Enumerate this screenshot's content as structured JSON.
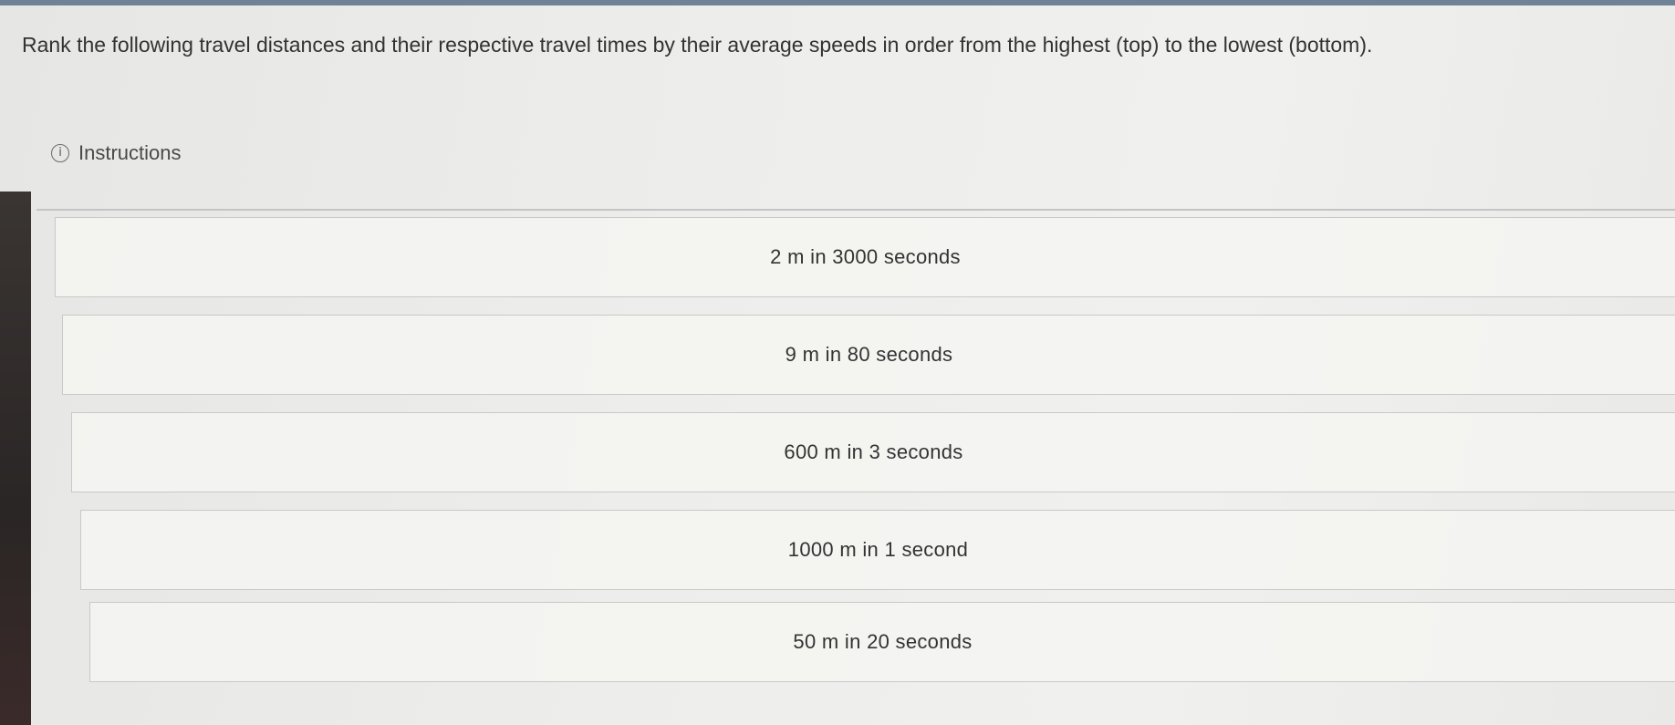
{
  "question": {
    "prompt": "Rank the following travel distances and their respective travel times by their average speeds in order from the highest (top) to the lowest (bottom)."
  },
  "instructions": {
    "icon": "info-icon",
    "icon_glyph": "i",
    "label": "Instructions"
  },
  "ranking_items": [
    {
      "label": "2 m in 3000 seconds"
    },
    {
      "label": "9 m in 80 seconds"
    },
    {
      "label": "600 m in 3 seconds"
    },
    {
      "label": "1000 m in 1 second"
    },
    {
      "label": "50 m in 20 seconds"
    }
  ]
}
